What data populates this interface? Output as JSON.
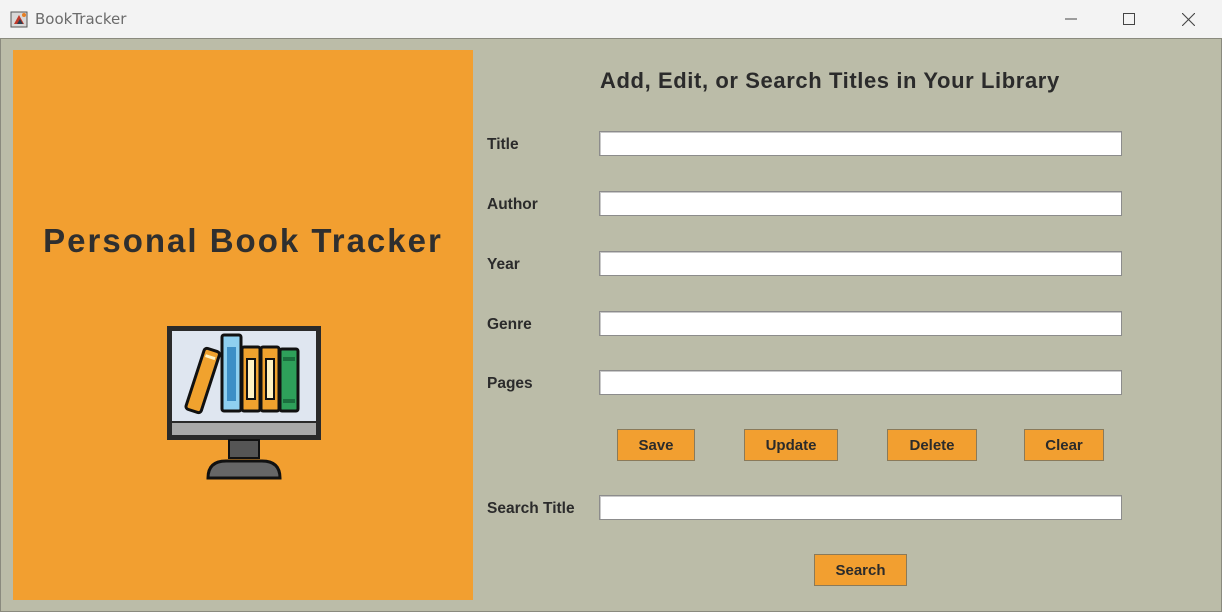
{
  "window": {
    "title": "BookTracker",
    "icon": "java-app-icon",
    "controls": [
      "minimize-icon",
      "maximize-icon",
      "close-icon"
    ]
  },
  "left_panel": {
    "title": "Personal Book Tracker",
    "illustration": "monitor-with-books-icon",
    "background": "#f29f30"
  },
  "form": {
    "heading": "Add, Edit, or Search Titles in Your Library",
    "fields": [
      {
        "label": "Title",
        "value": ""
      },
      {
        "label": "Author",
        "value": ""
      },
      {
        "label": "Year",
        "value": ""
      },
      {
        "label": "Genre",
        "value": ""
      },
      {
        "label": "Pages",
        "value": ""
      }
    ],
    "buttons": {
      "save": "Save",
      "update": "Update",
      "delete": "Delete",
      "clear": "Clear"
    },
    "search": {
      "label": "Search Title",
      "value": "",
      "button": "Search"
    }
  },
  "colors": {
    "accent": "#f29f30",
    "background": "#bbbca8",
    "text": "#2b2b2b"
  }
}
